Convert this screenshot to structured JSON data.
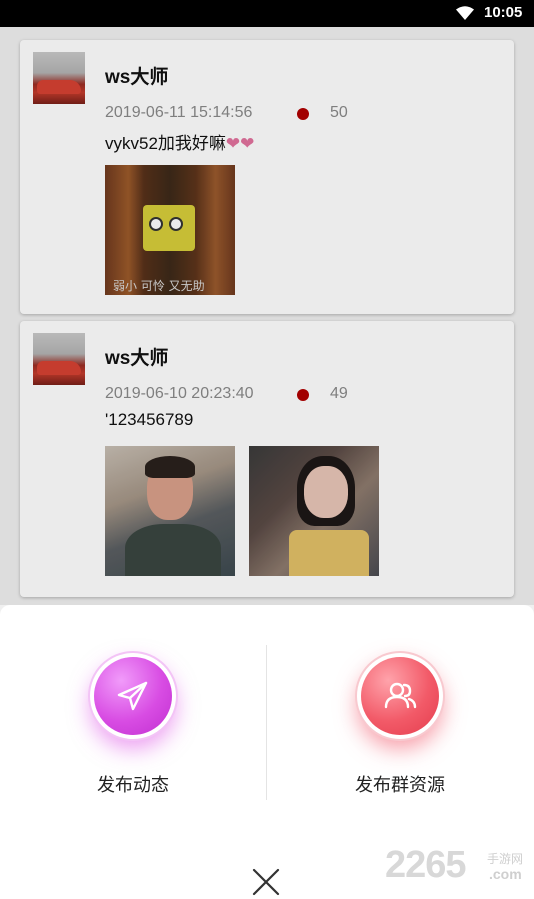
{
  "status_bar": {
    "time": "10:05",
    "wifi_icon": "wifi-icon"
  },
  "feed": {
    "posts": [
      {
        "username": "ws大师",
        "date": "2019-06-11 15:14:56",
        "count": "50",
        "content": "vykv52加我好嘛",
        "content_emoji": "❤❤",
        "images": [
          {
            "caption": "弱小 可怜 又无助"
          }
        ]
      },
      {
        "username": "ws大师",
        "date": "2019-06-10 20:23:40",
        "count": "49",
        "content": "'123456789",
        "images": [
          {
            "caption": ""
          },
          {
            "caption": ""
          }
        ]
      }
    ]
  },
  "sheet": {
    "actions": [
      {
        "label": "发布动态",
        "icon": "paper-plane-icon",
        "color": "#d84ce3"
      },
      {
        "label": "发布群资源",
        "icon": "group-users-icon",
        "color": "#f25a68"
      }
    ],
    "close_icon": "close-icon"
  },
  "watermark": {
    "number": "2265",
    "site_cn": "手游网",
    "domain": ".com"
  }
}
